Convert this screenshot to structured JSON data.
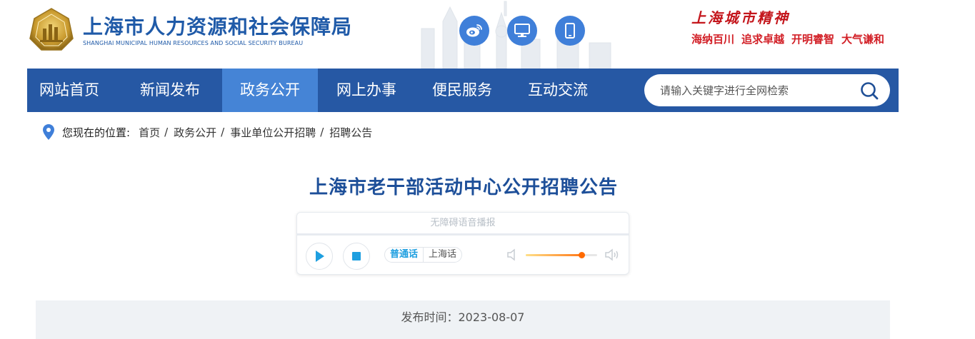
{
  "header": {
    "title": "上海市人力资源和社会保障局",
    "subtitle": "SHANGHAI MUNICIPAL HUMAN RESOURCES AND SOCIAL SECURITY BUREAU",
    "icons": [
      "weibo-icon",
      "desktop-icon",
      "mobile-icon"
    ],
    "spirit": {
      "title": "上海城市精神",
      "items": [
        "海纳百川",
        "追求卓越",
        "开明睿智",
        "大气谦和"
      ]
    }
  },
  "nav": {
    "items": [
      "网站首页",
      "新闻发布",
      "政务公开",
      "网上办事",
      "便民服务",
      "互动交流"
    ],
    "active_index": 2,
    "search_placeholder": "请输入关键字进行全网检索"
  },
  "breadcrumb": {
    "label": "您现在的位置:",
    "items": [
      "首页",
      "政务公开",
      "事业单位公开招聘",
      "招聘公告"
    ],
    "separator": "/"
  },
  "article": {
    "title": "上海市老干部活动中心公开招聘公告",
    "publish": "发布时间：2023-08-07"
  },
  "player": {
    "header": "无障碍语音播报",
    "progress": 0,
    "languages": [
      "普通话",
      "上海话"
    ],
    "selected_language": "普通话",
    "volume": 0.78
  },
  "colors": {
    "brand": "#2658a4",
    "nav_active": "#4584d6",
    "title": "#1d4f99",
    "spirit": "#c4161c",
    "volume": "#ff6a00"
  }
}
